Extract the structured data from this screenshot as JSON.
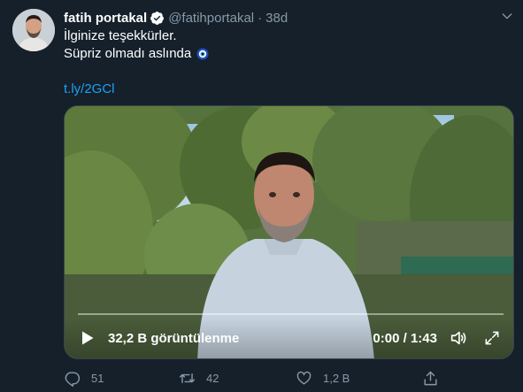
{
  "author": {
    "name": "fatih portakal",
    "handle": "@fatihportakal",
    "separator": "·",
    "time": "38d",
    "verified": true
  },
  "tweet": {
    "line1": "İlginize teşekkürler.",
    "line2": "Süpriz olmadı aslında",
    "emoji": "nazar-boncugu",
    "link": "t.ly/2GCl"
  },
  "video": {
    "views": "32,2 B görüntülenme",
    "current_time": "0:00",
    "time_separator": "/",
    "duration": "1:43",
    "progress": 0.0
  },
  "actions": {
    "reply_count": "51",
    "retweet_count": "42",
    "like_count": "1,2 B"
  },
  "colors": {
    "background": "#15202b",
    "secondary_text": "#8899a6",
    "link": "#1da1f2",
    "verified": "#ffffff"
  },
  "icons": {
    "caret": "chevron-down-icon",
    "verified": "verified-badge-icon",
    "play": "play-icon",
    "volume": "volume-icon",
    "fullscreen": "fullscreen-icon",
    "reply": "reply-icon",
    "retweet": "retweet-icon",
    "like": "heart-icon",
    "share": "share-icon"
  }
}
